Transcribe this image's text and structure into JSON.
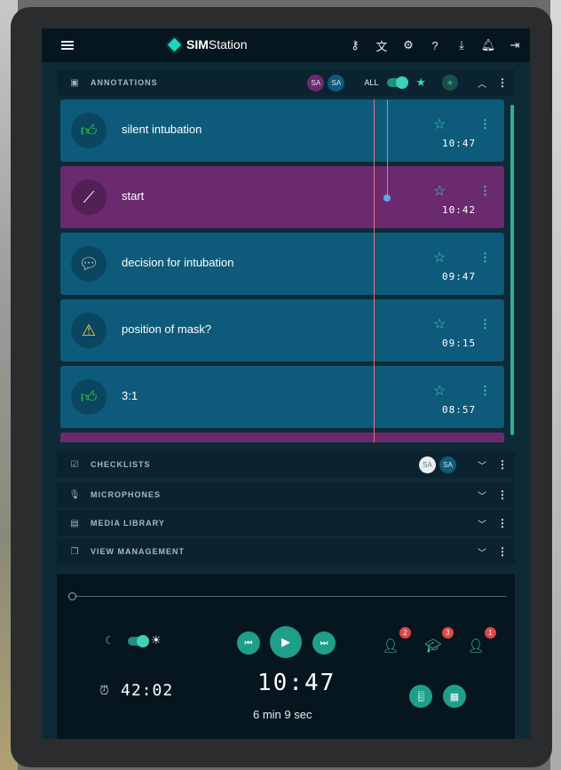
{
  "app": {
    "logo_prefix": "SIM",
    "logo_suffix": "Station",
    "top_icons": [
      "key-icon",
      "translate-icon",
      "settings-icon",
      "help-icon",
      "download-icon",
      "bell-icon",
      "logout-icon"
    ]
  },
  "annotations_section": {
    "title": "ANNOTATIONS",
    "avatars": [
      {
        "initials": "SA",
        "color": "#6b2a6e"
      },
      {
        "initials": "SA",
        "color": "#0e5a7a"
      }
    ],
    "all_label": "ALL",
    "items": [
      {
        "label": "silent intubation",
        "time": "10:47",
        "icon": "thumbs-up-icon",
        "color": "#0e5a7a"
      },
      {
        "label": "start",
        "time": "10:42",
        "icon": "pen-icon",
        "color": "#6b2a6e"
      },
      {
        "label": "decision for intubation",
        "time": "09:47",
        "icon": "comment-icon",
        "color": "#0e5a7a"
      },
      {
        "label": "position of mask?",
        "time": "09:15",
        "icon": "warning-icon",
        "color": "#0e5a7a"
      },
      {
        "label": "3:1",
        "time": "08:57",
        "icon": "thumbs-up-icon",
        "color": "#0e5a7a"
      }
    ]
  },
  "sections": [
    {
      "title": "CHECKLISTS",
      "icon": "checkbox-icon",
      "avatars": [
        "SA",
        "SA"
      ]
    },
    {
      "title": "MICROPHONES",
      "icon": "microphone-icon",
      "avatars": []
    },
    {
      "title": "MEDIA LIBRARY",
      "icon": "media-library-icon",
      "avatars": []
    },
    {
      "title": "VIEW MANAGEMENT",
      "icon": "view-management-icon",
      "avatars": []
    }
  ],
  "controls": {
    "countdown": "42:02",
    "clock": "10:47",
    "duration": "6 min 9 sec",
    "participants": [
      {
        "icon": "participant-icon",
        "count": "2"
      },
      {
        "icon": "student-icon",
        "count": "3"
      },
      {
        "icon": "instructor-icon",
        "count": "1"
      }
    ]
  }
}
